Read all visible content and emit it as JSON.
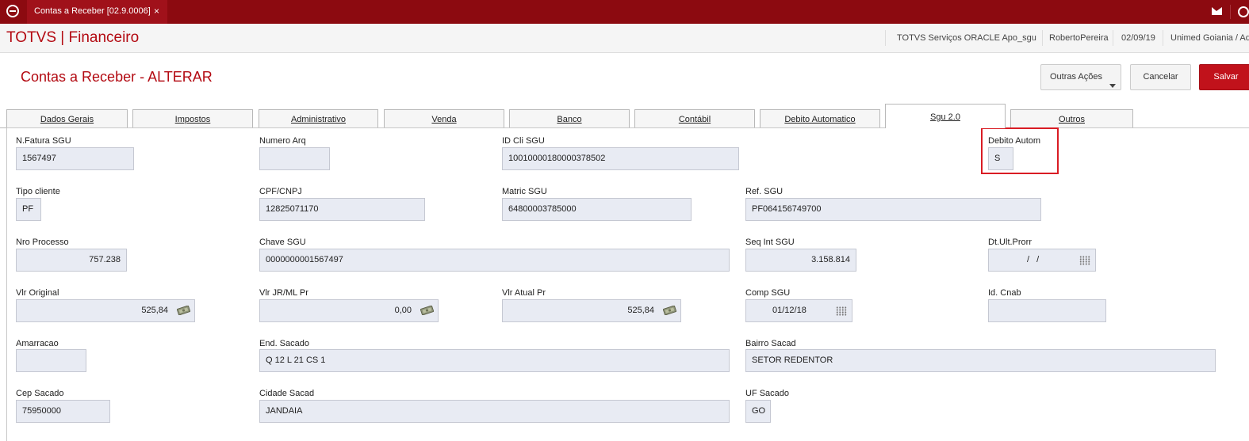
{
  "topbar": {
    "tab_title": "Contas a Receber [02.9.0006]",
    "close_glyph": "×",
    "brand_color": "#8c0a10"
  },
  "header": {
    "app_title": "TOTVS | Financeiro",
    "environment": "TOTVS Serviços ORACLE Apo_sgu",
    "user": "RobertoPereira",
    "date": "02/09/19",
    "company": "Unimed Goiania / Ad"
  },
  "page": {
    "title": "Contas a Receber - ALTERAR"
  },
  "actions": {
    "more": "Outras Ações",
    "cancel": "Cancelar",
    "save": "Salvar"
  },
  "tabs": [
    "Dados Gerais",
    "Impostos",
    "Administrativo",
    "Venda",
    "Banco",
    "Contábil",
    "Debito Automatico",
    "Sgu 2.0",
    "Outros"
  ],
  "active_tab": "Sgu 2.0",
  "fields": {
    "n_fatura_sgu": {
      "label": "N.Fatura SGU",
      "value": "1567497"
    },
    "numero_arq": {
      "label": "Numero Arq",
      "value": ""
    },
    "id_cli_sgu": {
      "label": "ID Cli SGU",
      "value": "10010000180000378502"
    },
    "debito_autom": {
      "label": "Debito Autom",
      "value": "S"
    },
    "tipo_cliente": {
      "label": "Tipo cliente",
      "value": "PF"
    },
    "cpf_cnpj": {
      "label": "CPF/CNPJ",
      "value": "12825071170"
    },
    "matric_sgu": {
      "label": "Matric SGU",
      "value": "64800003785000"
    },
    "ref_sgu": {
      "label": "Ref. SGU",
      "value": "PF064156749700"
    },
    "nro_processo": {
      "label": "Nro Processo",
      "value": "757.238"
    },
    "chave_sgu": {
      "label": "Chave SGU",
      "value": "0000000001567497"
    },
    "seq_int_sgu": {
      "label": "Seq Int SGU",
      "value": "3.158.814"
    },
    "dt_ult_prorr": {
      "label": "Dt.Ult.Prorr",
      "value": "/ /"
    },
    "vlr_original": {
      "label": "Vlr Original",
      "value": "525,84"
    },
    "vlr_jr_ml_pr": {
      "label": "Vlr JR/ML Pr",
      "value": "0,00"
    },
    "vlr_atual_pr": {
      "label": "Vlr Atual Pr",
      "value": "525,84"
    },
    "comp_sgu": {
      "label": "Comp SGU",
      "value": "01/12/18"
    },
    "id_cnab": {
      "label": "Id. Cnab",
      "value": ""
    },
    "amarracao": {
      "label": "Amarracao",
      "value": ""
    },
    "end_sacado": {
      "label": "End. Sacado",
      "value": "Q 12 L 21 CS 1"
    },
    "bairro_sacad": {
      "label": "Bairro Sacad",
      "value": "SETOR REDENTOR"
    },
    "cep_sacado": {
      "label": "Cep Sacado",
      "value": "75950000"
    },
    "cidade_sacad": {
      "label": "Cidade Sacad",
      "value": "JANDAIA"
    },
    "uf_sacado": {
      "label": "UF Sacado",
      "value": "GO"
    }
  }
}
